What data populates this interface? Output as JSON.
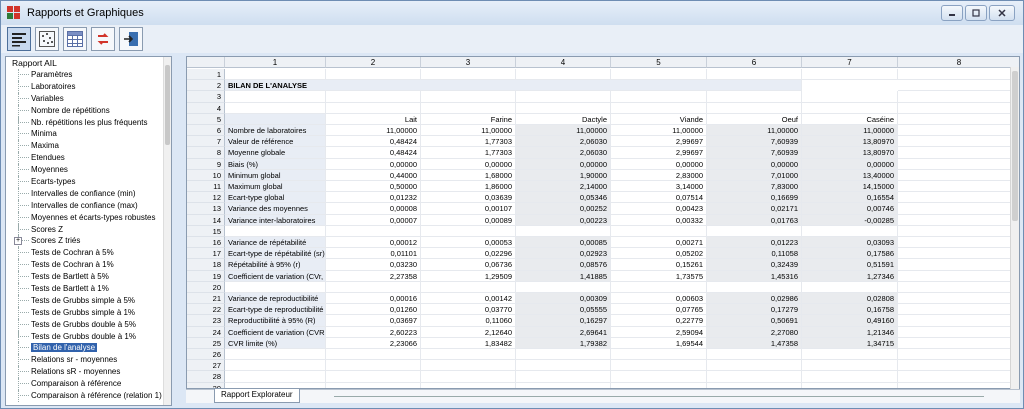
{
  "window": {
    "title": "Rapports et Graphiques"
  },
  "toolbar": {
    "buttons": [
      {
        "name": "report-view-icon"
      },
      {
        "name": "scatter-view-icon"
      },
      {
        "name": "grid-view-icon"
      },
      {
        "name": "arrows-icon"
      },
      {
        "name": "export-icon"
      }
    ]
  },
  "tree": {
    "root": "Rapport AIL",
    "items": [
      "Paramètres",
      "Laboratoires",
      "Variables",
      "Nombre de répétitions",
      "Nb. répétitions les plus fréquents",
      "Minima",
      "Maxima",
      "Etendues",
      "Moyennes",
      "Ecarts-types",
      "Intervalles de confiance (min)",
      "Intervalles de confiance (max)",
      "Moyennes et écarts-types robustes",
      "Scores Z",
      "Scores Z triés",
      "Tests de Cochran à 5%",
      "Tests de Cochran à 1%",
      "Tests de Bartlett à 5%",
      "Tests de Bartlett à 1%",
      "Tests de Grubbs simple à 5%",
      "Tests de Grubbs simple à 1%",
      "Tests de Grubbs double à 5%",
      "Tests de Grubbs double à 1%",
      "Bilan de l'analyse",
      "Relations sr - moyennes",
      "Relations sR - moyennes",
      "Comparaison à référence",
      "Comparaison à référence (relation 1)"
    ],
    "selected_index": 23,
    "expandable_index": 14
  },
  "grid": {
    "columns": [
      "1",
      "2",
      "3",
      "4",
      "5",
      "6",
      "7",
      "8"
    ],
    "title": "BILAN DE L'ANALYSE",
    "headers": [
      "Lait",
      "Farine",
      "Dactyle",
      "Viande",
      "Oeuf",
      "Caséine"
    ],
    "rows": [
      {
        "n": "1",
        "label": "",
        "v": []
      },
      {
        "n": "2",
        "label": "BILAN DE L'ANALYSE",
        "v": [],
        "title": true
      },
      {
        "n": "3",
        "label": "",
        "v": []
      },
      {
        "n": "4",
        "label": "",
        "v": []
      },
      {
        "n": "5",
        "label": "",
        "v": [
          "Lait",
          "Farine",
          "Dactyle",
          "Viande",
          "Oeuf",
          "Caséine"
        ],
        "header": true
      },
      {
        "n": "6",
        "label": "Nombre de laboratoires",
        "v": [
          "11,00000",
          "11,00000",
          "11,00000",
          "11,00000",
          "11,00000",
          "11,00000"
        ]
      },
      {
        "n": "7",
        "label": "Valeur de référence",
        "v": [
          "0,48424",
          "1,77303",
          "2,06030",
          "2,99697",
          "7,60939",
          "13,80970"
        ]
      },
      {
        "n": "8",
        "label": "Moyenne globale",
        "v": [
          "0,48424",
          "1,77303",
          "2,06030",
          "2,99697",
          "7,60939",
          "13,80970"
        ]
      },
      {
        "n": "9",
        "label": "Biais (%)",
        "v": [
          "0,00000",
          "0,00000",
          "0,00000",
          "0,00000",
          "0,00000",
          "0,00000"
        ]
      },
      {
        "n": "10",
        "label": "Minimum global",
        "v": [
          "0,44000",
          "1,68000",
          "1,90000",
          "2,83000",
          "7,01000",
          "13,40000"
        ]
      },
      {
        "n": "11",
        "label": "Maximum global",
        "v": [
          "0,50000",
          "1,86000",
          "2,14000",
          "3,14000",
          "7,83000",
          "14,15000"
        ]
      },
      {
        "n": "12",
        "label": "Ecart-type global",
        "v": [
          "0,01232",
          "0,03639",
          "0,05346",
          "0,07514",
          "0,16699",
          "0,16554"
        ]
      },
      {
        "n": "13",
        "label": "Variance des moyennes",
        "v": [
          "0,00008",
          "0,00107",
          "0,00252",
          "0,00423",
          "0,02171",
          "0,00746"
        ]
      },
      {
        "n": "14",
        "label": "Variance inter-laboratoires",
        "v": [
          "0,00007",
          "0,00089",
          "0,00223",
          "0,00332",
          "0,01763",
          "-0,00285"
        ]
      },
      {
        "n": "15",
        "label": "",
        "v": []
      },
      {
        "n": "16",
        "label": "Variance de répétabilité",
        "v": [
          "0,00012",
          "0,00053",
          "0,00085",
          "0,00271",
          "0,01223",
          "0,03093"
        ]
      },
      {
        "n": "17",
        "label": "Ecart-type de répétabilité (sr)",
        "v": [
          "0,01101",
          "0,02296",
          "0,02923",
          "0,05202",
          "0,11058",
          "0,17586"
        ]
      },
      {
        "n": "18",
        "label": "Répétabilité à 95% (r)",
        "v": [
          "0,03230",
          "0,06736",
          "0,08576",
          "0,15261",
          "0,32439",
          "0,51591"
        ]
      },
      {
        "n": "19",
        "label": "Coefficient de variation (CVr, %)",
        "v": [
          "2,27358",
          "1,29509",
          "1,41885",
          "1,73575",
          "1,45316",
          "1,27346"
        ]
      },
      {
        "n": "20",
        "label": "",
        "v": []
      },
      {
        "n": "21",
        "label": "Variance de reproductibilité",
        "v": [
          "0,00016",
          "0,00142",
          "0,00309",
          "0,00603",
          "0,02986",
          "0,02808"
        ]
      },
      {
        "n": "22",
        "label": "Ecart-type de reproductibilité (sR)",
        "v": [
          "0,01260",
          "0,03770",
          "0,05555",
          "0,07765",
          "0,17279",
          "0,16758"
        ]
      },
      {
        "n": "23",
        "label": "Reproductibilité à 95% (R)",
        "v": [
          "0,03697",
          "0,11060",
          "0,16297",
          "0,22779",
          "0,50691",
          "0,49160"
        ]
      },
      {
        "n": "24",
        "label": "Coefficient de variation (CVR, %)",
        "v": [
          "2,60223",
          "2,12640",
          "2,69641",
          "2,59094",
          "2,27080",
          "1,21346"
        ]
      },
      {
        "n": "25",
        "label": "CVR limite (%)",
        "v": [
          "2,23066",
          "1,83482",
          "1,79382",
          "1,69544",
          "1,47358",
          "1,34715"
        ]
      },
      {
        "n": "26",
        "label": "",
        "v": []
      },
      {
        "n": "27",
        "label": "",
        "v": []
      },
      {
        "n": "28",
        "label": "",
        "v": []
      },
      {
        "n": "29",
        "label": "",
        "v": []
      }
    ]
  },
  "tabs": {
    "active": "Rapport Explorateur"
  },
  "colors": {
    "selection": "#3162ac",
    "label_bg": "#e8edf5",
    "shade_bg": "#e9ebee"
  }
}
